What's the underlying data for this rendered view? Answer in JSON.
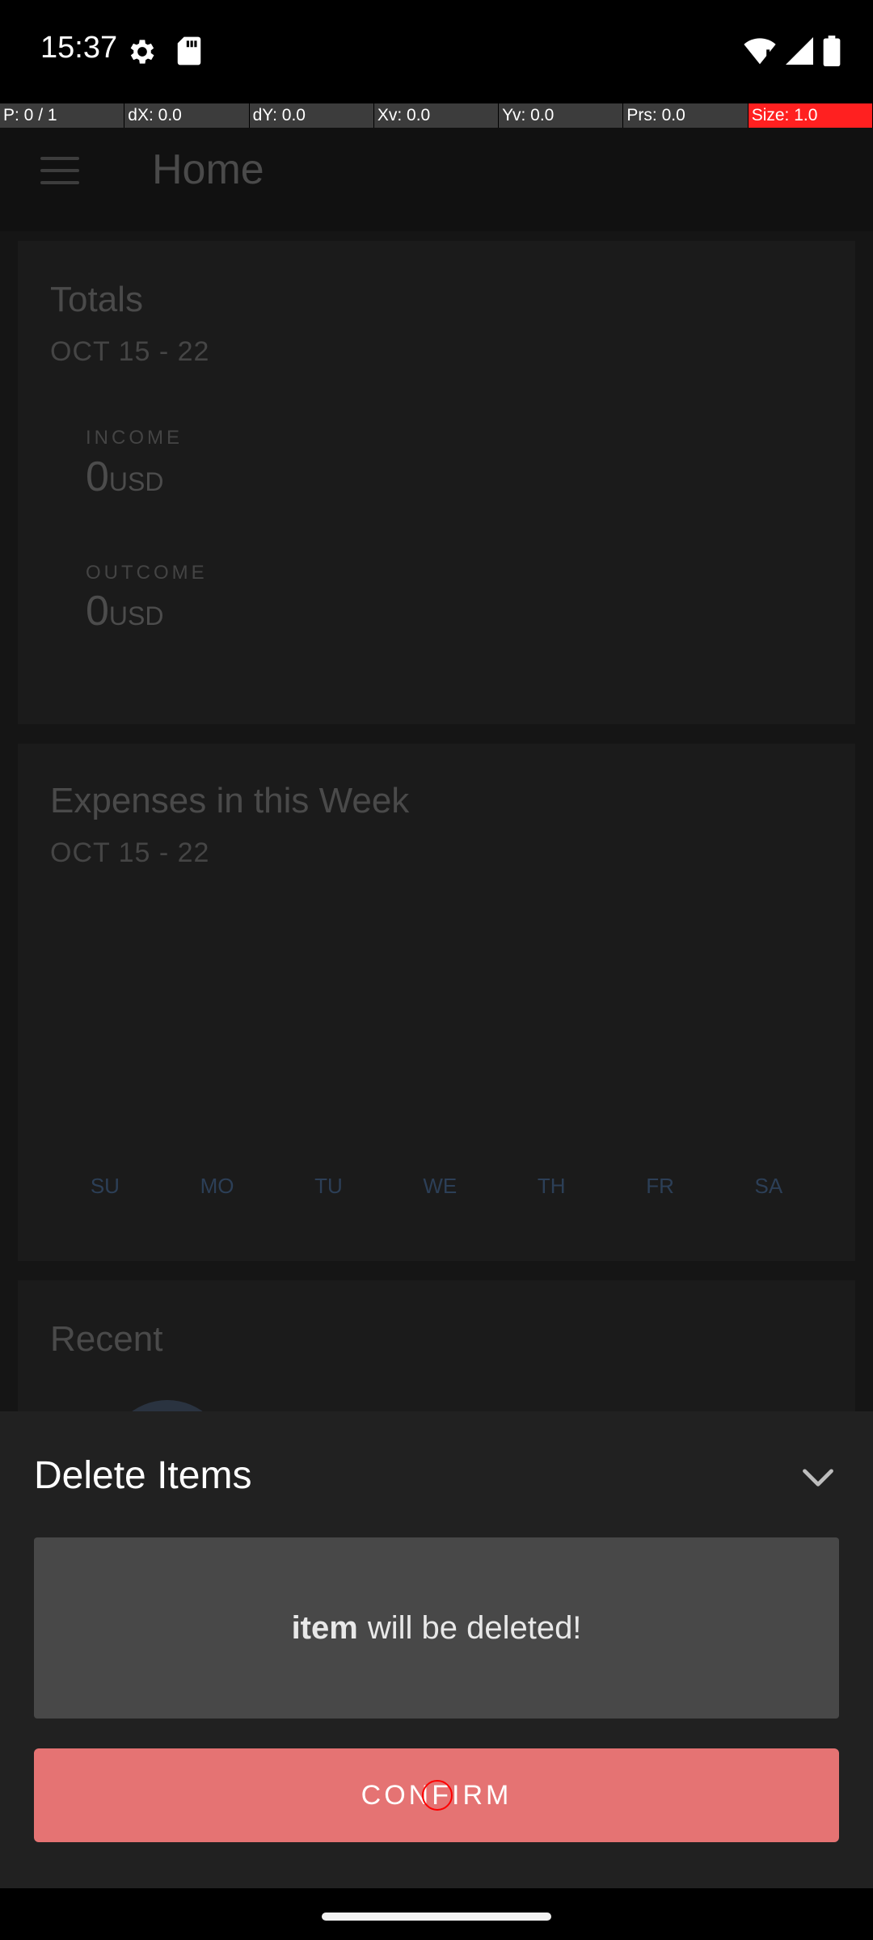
{
  "status_bar": {
    "time": "15:37",
    "icons": [
      "settings-gear-icon",
      "sd-card-icon",
      "wifi-icon",
      "signal-icon",
      "battery-icon"
    ]
  },
  "debug_bar": {
    "cells": [
      "P: 0 / 1",
      "dX: 0.0",
      "dY: 0.0",
      "Xv: 0.0",
      "Yv: 0.0",
      "Prs: 0.0",
      "Size: 1.0"
    ]
  },
  "app": {
    "title": "Home",
    "totals": {
      "title": "Totals",
      "range": "OCT 15 - 22",
      "income_label": "INCOME",
      "income_value": "0",
      "income_currency": "USD",
      "outcome_label": "OUTCOME",
      "outcome_value": "0",
      "outcome_currency": "USD"
    },
    "expenses": {
      "title": "Expenses in this Week",
      "range": "OCT 15 - 22",
      "days": [
        "SU",
        "MO",
        "TU",
        "WE",
        "TH",
        "FR",
        "SA"
      ]
    },
    "recent": {
      "title": "Recent"
    }
  },
  "sheet": {
    "title": "Delete Items",
    "message_bold": "item",
    "message_rest": "will be deleted!",
    "confirm_label": "CONFIRM"
  },
  "colors": {
    "confirm": "#e57373",
    "sheet_bg": "#212121",
    "message_bg": "#484848"
  }
}
